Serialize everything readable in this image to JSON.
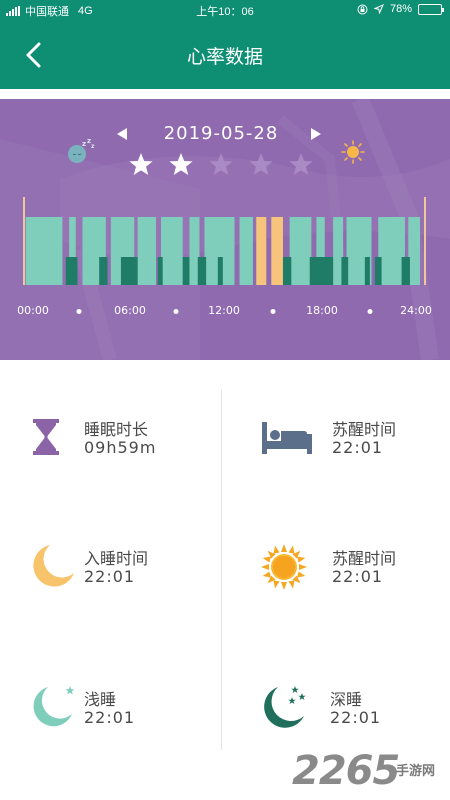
{
  "status_bar": {
    "carrier": "中国联通",
    "network": "4G",
    "time": "上午10：06",
    "battery": "78%",
    "battery_level": 0.78
  },
  "nav": {
    "title": "心率数据",
    "back_icon": "chevron-left-icon"
  },
  "day": {
    "date": "2019-05-28",
    "prev_icon": "triangle-left-icon",
    "next_icon": "triangle-right-icon",
    "rating": 2,
    "rating_max": 5,
    "star_on_color": "#ffffff",
    "star_off_color": "#a98ac4"
  },
  "chart_data": {
    "type": "bar",
    "x_ticks": [
      "00:00",
      "06:00",
      "12:00",
      "18:00",
      "24:00"
    ],
    "xlim": [
      0,
      24
    ],
    "colors": {
      "light": "#7fcdbb",
      "deep": "#1f7c66",
      "awake": "#f6c47c",
      "background": "#8f6aae",
      "marker": "#f0c79a"
    },
    "segments": [
      {
        "stage": "light",
        "start": 0.1,
        "end": 2.3
      },
      {
        "stage": "light",
        "start": 2.7,
        "end": 3.1
      },
      {
        "stage": "light",
        "start": 3.5,
        "end": 4.9
      },
      {
        "stage": "light",
        "start": 5.2,
        "end": 6.6
      },
      {
        "stage": "light",
        "start": 6.8,
        "end": 7.9
      },
      {
        "stage": "light",
        "start": 8.2,
        "end": 9.5
      },
      {
        "stage": "light",
        "start": 9.9,
        "end": 10.5
      },
      {
        "stage": "light",
        "start": 10.8,
        "end": 12.6
      },
      {
        "stage": "light",
        "start": 12.9,
        "end": 13.7
      },
      {
        "stage": "awake",
        "start": 13.9,
        "end": 14.5
      },
      {
        "stage": "awake",
        "start": 14.8,
        "end": 15.5
      },
      {
        "stage": "light",
        "start": 15.9,
        "end": 17.2
      },
      {
        "stage": "light",
        "start": 17.5,
        "end": 18.0
      },
      {
        "stage": "light",
        "start": 18.5,
        "end": 19.1
      },
      {
        "stage": "light",
        "start": 19.3,
        "end": 20.8
      },
      {
        "stage": "light",
        "start": 21.2,
        "end": 22.8
      },
      {
        "stage": "light",
        "start": 23.0,
        "end": 23.7
      }
    ],
    "deep": [
      {
        "start": 2.5,
        "end": 3.2
      },
      {
        "start": 4.5,
        "end": 5.0
      },
      {
        "start": 5.8,
        "end": 6.8
      },
      {
        "start": 8.0,
        "end": 8.3
      },
      {
        "start": 9.5,
        "end": 9.9
      },
      {
        "start": 10.4,
        "end": 10.9
      },
      {
        "start": 11.6,
        "end": 11.9
      },
      {
        "start": 15.5,
        "end": 16.0
      },
      {
        "start": 17.1,
        "end": 18.5
      },
      {
        "start": 19.0,
        "end": 19.4
      },
      {
        "start": 20.4,
        "end": 20.7
      },
      {
        "start": 21.0,
        "end": 21.4
      },
      {
        "start": 22.6,
        "end": 23.1
      }
    ],
    "markers": [
      0.0,
      24.0
    ]
  },
  "stats": {
    "duration": {
      "label": "睡眠时长",
      "value": "09h59m",
      "icon": "hourglass-icon"
    },
    "wake_bed": {
      "label": "苏醒时间",
      "value": "22:01",
      "icon": "bed-icon"
    },
    "sleep_time": {
      "label": "入睡时间",
      "value": "22:01",
      "icon": "crescent-moon-icon"
    },
    "wake_sun": {
      "label": "苏醒时间",
      "value": "22:01",
      "icon": "sun-icon"
    },
    "light": {
      "label": "浅睡",
      "value": "22:01",
      "icon": "light-sleep-moon-icon"
    },
    "deep": {
      "label": "深睡",
      "value": "22:01",
      "icon": "deep-sleep-moon-icon"
    }
  },
  "watermark": {
    "brand": "2265",
    "suffix": "手游网"
  }
}
